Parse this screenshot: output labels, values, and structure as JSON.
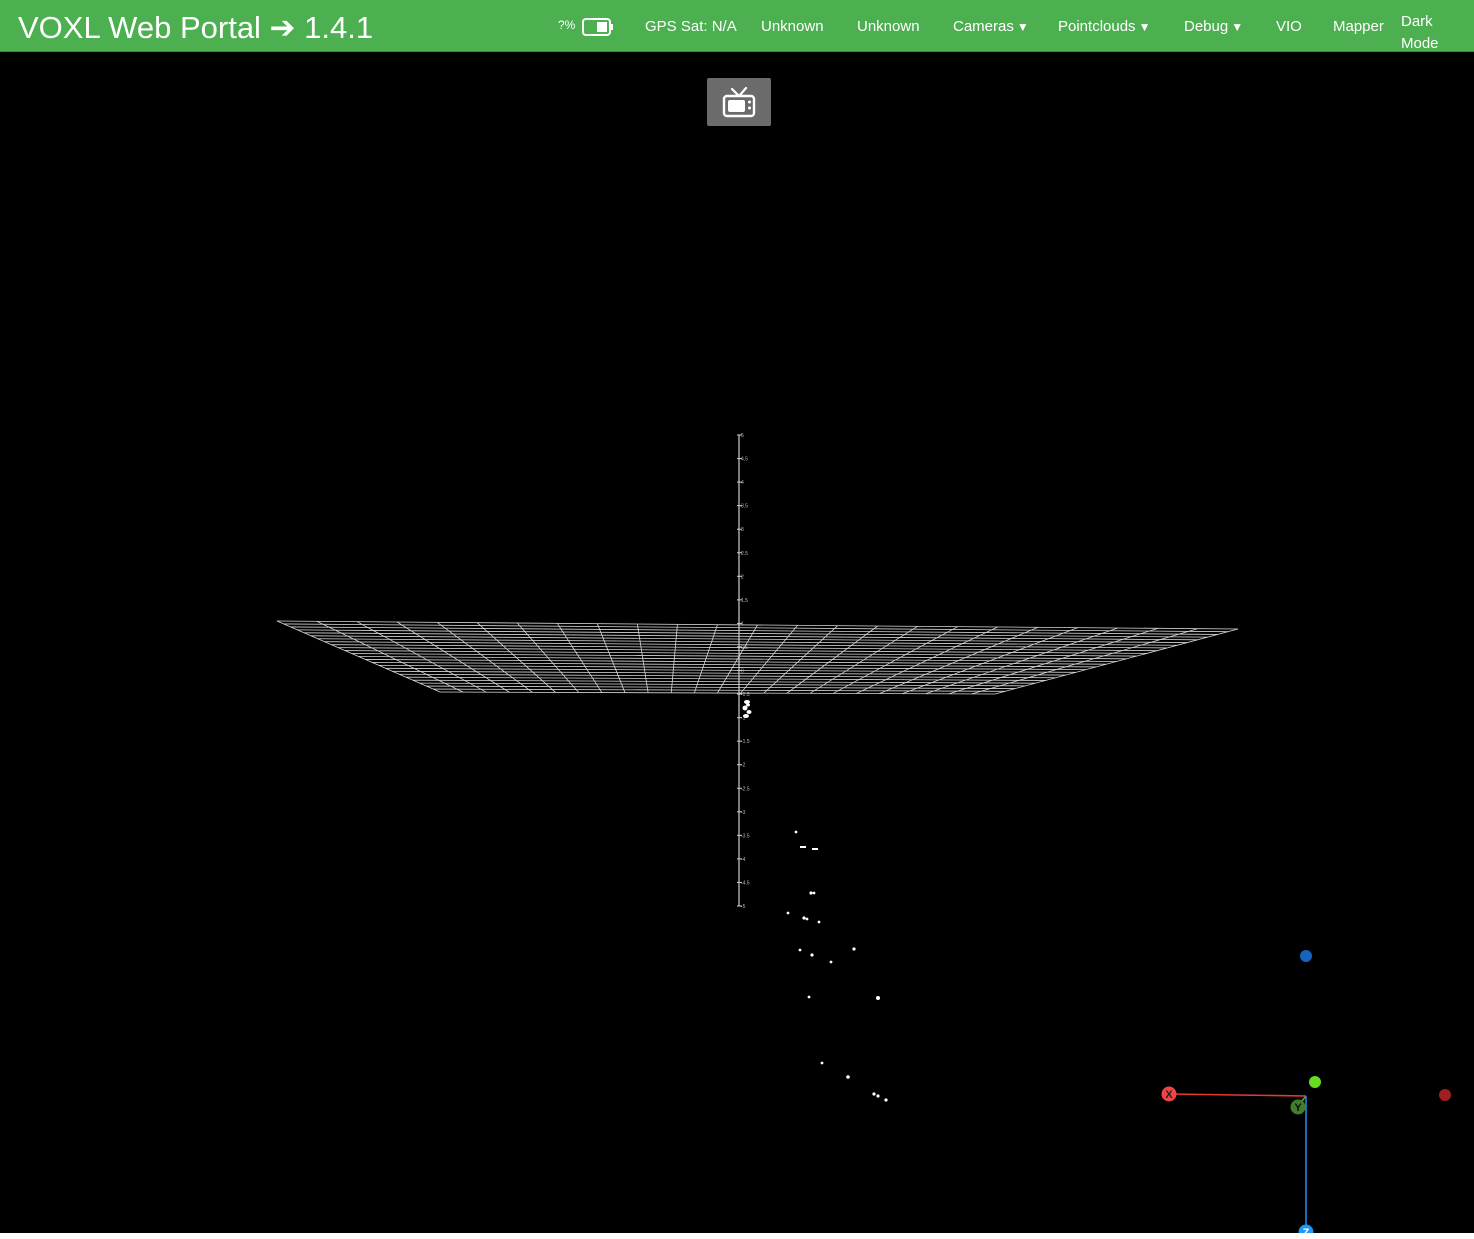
{
  "navbar": {
    "brand": "VOXL Web Portal ➔ 1.4.1",
    "battery_percent": "?%",
    "gps": "GPS Sat: N/A",
    "status_1": "Unknown",
    "status_2": "Unknown",
    "menu": {
      "cameras": "Cameras",
      "pointclouds": "Pointclouds",
      "debug": "Debug",
      "vio": "VIO",
      "mapper": "Mapper",
      "dark_mode": "Dark Mode"
    },
    "caret": "▼",
    "colors": {
      "background": "#4caf50",
      "text": "#ffffff"
    }
  },
  "view_button": {
    "icon": "tv-icon",
    "color": "#6b6b6b"
  },
  "scene": {
    "background": "#000000",
    "grid_color": "#ffffff",
    "axis_ticks": [
      "5",
      "4.5",
      "4",
      "3.5",
      "3",
      "2.5",
      "2",
      "1.5",
      "1",
      "0.5",
      "0",
      "-0.5",
      "-1",
      "-1.5",
      "-2",
      "-2.5",
      "-3",
      "-3.5",
      "-4",
      "-4.5",
      "-5"
    ],
    "gizmo": {
      "x_label": "X",
      "y_label": "Y",
      "z_label": "Z",
      "x_color": "#e53935",
      "y_color": "#4caf50",
      "z_color": "#1e88e5"
    }
  }
}
